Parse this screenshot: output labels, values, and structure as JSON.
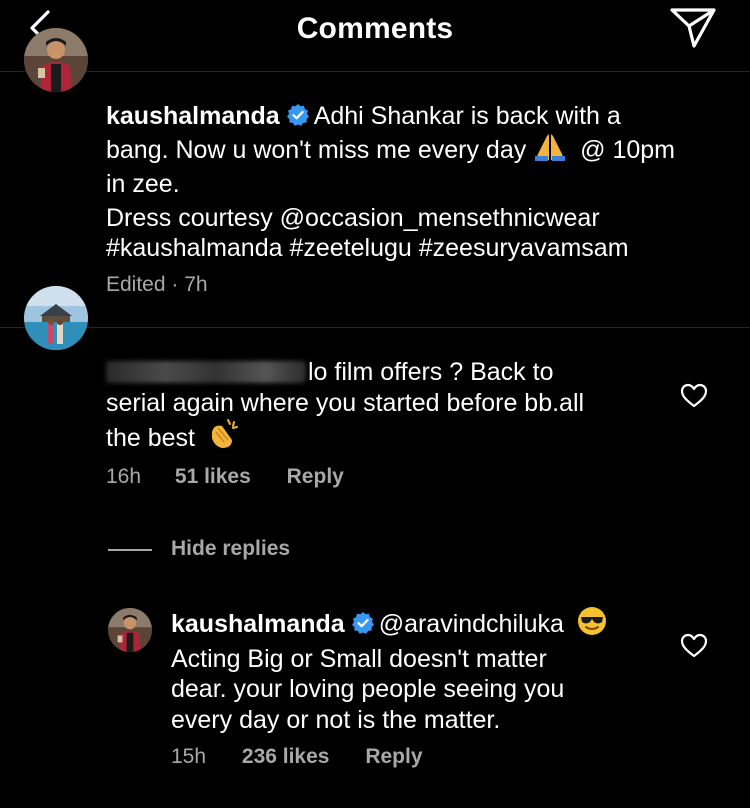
{
  "header": {
    "title": "Comments",
    "back_icon": "chevron-left-icon",
    "send_icon": "paper-plane-icon"
  },
  "caption": {
    "username": "kaushalmanda",
    "verified": true,
    "line1": "Adhi Shankar is back with a",
    "line2": "bang. Now u won't miss me every day",
    "emoji_after_line2": "🙏",
    "line2_tail": "@ 10pm",
    "line3": "in zee.",
    "line4": "Dress courtesy @occasion_mensethnicwear",
    "line5": "#kaushalmanda #zeetelugu #zeesuryavamsam",
    "meta": "Edited · 7h"
  },
  "comment": {
    "username_redacted": true,
    "line1": "lo film offers ? Back to",
    "line2": "serial again where you started before bb.all",
    "line3": "the best",
    "emoji": "👏",
    "time": "16h",
    "likes": "51 likes",
    "reply": "Reply"
  },
  "replies_toggle": "Hide replies",
  "reply": {
    "username": "kaushalmanda",
    "verified": true,
    "mention": "@aravindchiluka",
    "emoji": "😎",
    "line2": "Acting Big or Small doesn't matter",
    "line3": "dear. your loving people seeing you",
    "line4": "every day or not is the matter.",
    "time": "15h",
    "likes": "236 likes",
    "reply": "Reply"
  },
  "colors": {
    "background": "#000000",
    "text": "#ffffff",
    "secondary": "#a8a8a8",
    "verified": "#3897f0",
    "divider": "#262626"
  }
}
